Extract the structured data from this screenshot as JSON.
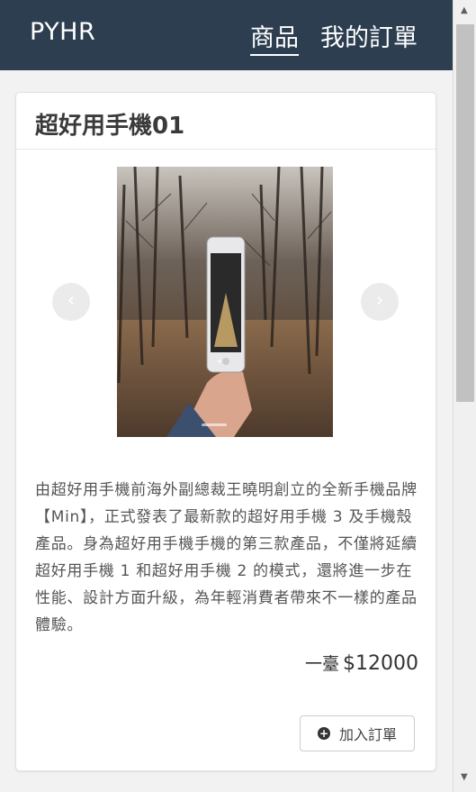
{
  "navbar": {
    "brand": "PYHR",
    "links": [
      {
        "label": "商品",
        "active": true
      },
      {
        "label": "我的訂單",
        "active": false
      }
    ],
    "background": "#2c3e50"
  },
  "product": {
    "title": "超好用手機01",
    "image_alt": "hand holding smartphone in forest",
    "description": "由超好用手機前海外副總裁王曉明創立的全新手機品牌【Min】，正式發表了最新款的超好用手機 3 及手機殼產品。身為超好用手機手機的第三款產品，不僅將延續超好用手機 1 和超好用手機 2 的模式，還將進一步在性能、設計方面升級，為年輕消費者帶來不一樣的產品體驗。",
    "price_unit": "一臺",
    "price": "$12000"
  },
  "carousel": {
    "prev_icon": "chevron-left-icon",
    "next_icon": "chevron-right-icon",
    "prev_glyph": "‹",
    "next_glyph": "›"
  },
  "actions": {
    "add_order_label": "加入訂單",
    "add_order_icon": "plus-circle-icon"
  }
}
